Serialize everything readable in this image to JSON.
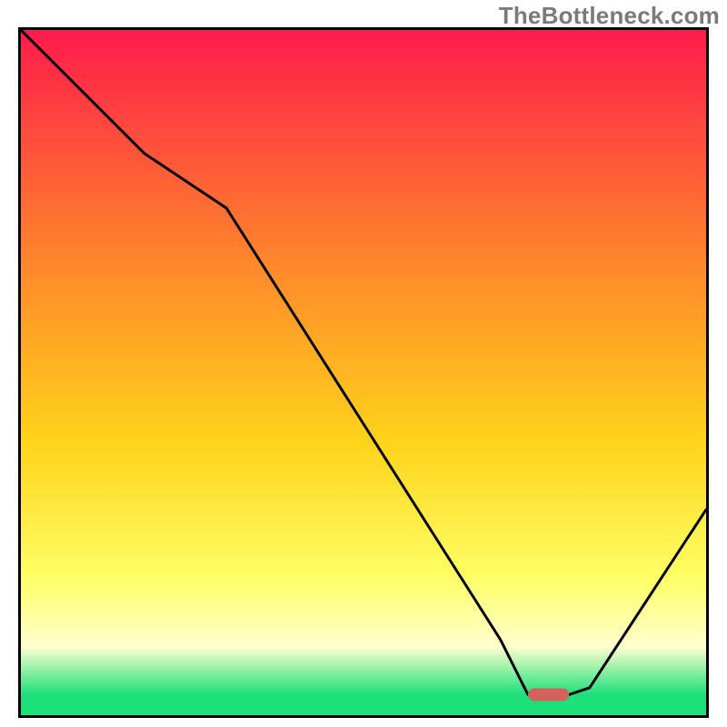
{
  "watermark": "TheBottleneck.com",
  "colors": {
    "top": "#ff1b4b",
    "mid_upper": "#ff8a2b",
    "mid": "#ffd31a",
    "mid_lower": "#ffff66",
    "pale": "#ffffd0",
    "bottom": "#1ee07a",
    "curve": "#000000",
    "marker": "#d5615f",
    "border": "#000000"
  },
  "chart_data": {
    "type": "line",
    "title": "",
    "xlabel": "",
    "ylabel": "",
    "xlim": [
      0,
      100
    ],
    "ylim": [
      0,
      100
    ],
    "x": [
      0,
      18,
      30,
      70,
      74,
      80,
      83,
      100
    ],
    "values": [
      100,
      82,
      74,
      11,
      3,
      3,
      4,
      30
    ],
    "marker": {
      "x_start": 74,
      "x_end": 80,
      "y": 3
    },
    "gradient_stops": [
      {
        "offset": 0,
        "key": "top"
      },
      {
        "offset": 35,
        "key": "mid_upper"
      },
      {
        "offset": 60,
        "key": "mid"
      },
      {
        "offset": 80,
        "key": "mid_lower"
      },
      {
        "offset": 90,
        "key": "pale"
      },
      {
        "offset": 97,
        "key": "bottom"
      },
      {
        "offset": 100,
        "key": "bottom"
      }
    ]
  }
}
